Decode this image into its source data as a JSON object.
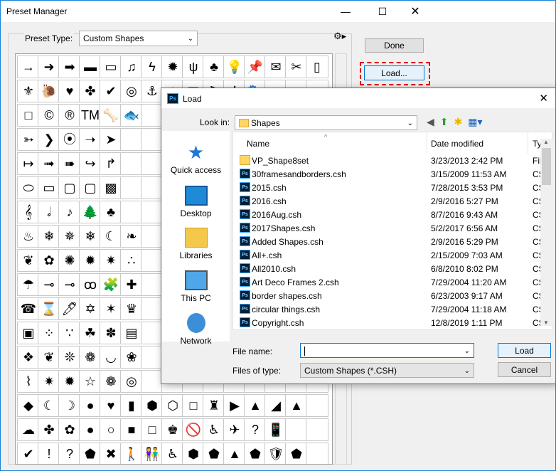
{
  "window": {
    "title": "Preset Manager"
  },
  "preset_type": {
    "label": "Preset Type:",
    "value": "Custom Shapes"
  },
  "buttons": {
    "done": "Done",
    "load": "Load..."
  },
  "shape_grid": {
    "rows": [
      [
        "→",
        "➜",
        "➡",
        "▬",
        "▭",
        "♫",
        "ϟ",
        "✹",
        "ψ",
        "♣",
        "💡",
        "📌",
        "✉",
        "✂",
        "▯"
      ],
      [
        "⚜",
        "🐌",
        "♥",
        "✤",
        "✔",
        "◎",
        "⚓",
        "◆",
        "▦",
        "⚑",
        "✲",
        "🐾",
        "",
        "",
        ""
      ],
      [
        "□",
        "©",
        "®",
        "TM",
        "🦴",
        "🐟",
        "",
        "",
        "",
        "",
        "",
        "",
        "",
        "",
        ""
      ],
      [
        "➳",
        "❯",
        "⦿",
        "➝",
        "➤",
        "",
        "",
        "",
        "",
        "",
        "",
        "",
        "",
        "",
        ""
      ],
      [
        "↦",
        "➟",
        "➠",
        "↪",
        "↱",
        "",
        "",
        "",
        "",
        "",
        "",
        "",
        "",
        "",
        ""
      ],
      [
        "⬭",
        "▭",
        "▢",
        "▢",
        "▩",
        "",
        "",
        "",
        "",
        "",
        "",
        "",
        "",
        "",
        ""
      ],
      [
        "𝄞",
        "𝅗𝅥",
        "♪",
        "🌲",
        "♣",
        "",
        "",
        "",
        "",
        "",
        "",
        "",
        "",
        "",
        ""
      ],
      [
        "♨",
        "❄",
        "✵",
        "❄",
        "☾",
        "❧",
        "",
        "",
        "",
        "",
        "",
        "",
        "",
        "",
        ""
      ],
      [
        "❦",
        "✿",
        "✺",
        "✹",
        "✷",
        "∴",
        "",
        "",
        "",
        "",
        "",
        "",
        "",
        "",
        ""
      ],
      [
        "☂",
        "⊸",
        "⊸",
        "ꝏ",
        "🧩",
        "✚",
        "",
        "",
        "",
        "",
        "",
        "",
        "",
        "",
        ""
      ],
      [
        "☎",
        "⌛",
        "🖊",
        "✡",
        "✶",
        "♛",
        "",
        "",
        "",
        "",
        "",
        "",
        "",
        "",
        ""
      ],
      [
        "▣",
        "⁘",
        "∵",
        "☘",
        "✽",
        "▤",
        "",
        "",
        "",
        "",
        "",
        "",
        "",
        "",
        ""
      ],
      [
        "❖",
        "❦",
        "❊",
        "❁",
        "◡",
        "❀",
        "",
        "",
        "",
        "",
        "",
        "",
        "",
        "",
        ""
      ],
      [
        "⌇",
        "✷",
        "✹",
        "☆",
        "❁",
        "◎",
        "",
        "",
        "",
        "",
        "",
        "",
        "",
        "",
        ""
      ],
      [
        "◆",
        "☾",
        "☽",
        "●",
        "♥",
        "▮",
        "⬢",
        "⬡",
        "□",
        "♜",
        "▶",
        "▲",
        "◢",
        "▲",
        ""
      ],
      [
        "☁",
        "✤",
        "✿",
        "●",
        "○",
        "■",
        "□",
        "♚",
        "🚫",
        "♿",
        "✈",
        "?",
        "📱",
        "",
        ""
      ],
      [
        "✔",
        "!",
        "?",
        "⬟",
        "✖",
        "🚶",
        "👫",
        "♿",
        "⬢",
        "⬟",
        "▲",
        "⬟",
        "🛡",
        "⬟",
        ""
      ]
    ]
  },
  "load_dialog": {
    "title": "Load",
    "look_in_label": "Look in:",
    "look_in_value": "Shapes",
    "places": [
      "Quick access",
      "Desktop",
      "Libraries",
      "This PC",
      "Network"
    ],
    "columns": {
      "name": "Name",
      "date": "Date modified",
      "type": "Ty"
    },
    "files": [
      {
        "name": "VP_Shape8set",
        "date": "3/23/2013 2:42 PM",
        "type": "Fil",
        "icon": "folder-icon"
      },
      {
        "name": "30framesandborders.csh",
        "date": "3/15/2009 11:53 AM",
        "type": "CS",
        "icon": "ps-file-icon"
      },
      {
        "name": "2015.csh",
        "date": "7/28/2015 3:53 PM",
        "type": "CS",
        "icon": "ps-file-icon"
      },
      {
        "name": "2016.csh",
        "date": "2/9/2016 5:27 PM",
        "type": "CS",
        "icon": "ps-file-icon"
      },
      {
        "name": "2016Aug.csh",
        "date": "8/7/2016 9:43 AM",
        "type": "CS",
        "icon": "ps-file-icon"
      },
      {
        "name": "2017Shapes.csh",
        "date": "5/2/2017 6:56 AM",
        "type": "CS",
        "icon": "ps-file-icon"
      },
      {
        "name": "Added Shapes.csh",
        "date": "2/9/2016 5:29 PM",
        "type": "CS",
        "icon": "ps-file-icon"
      },
      {
        "name": "All+.csh",
        "date": "2/15/2009 7:03 AM",
        "type": "CS",
        "icon": "ps-file-icon"
      },
      {
        "name": "All2010.csh",
        "date": "6/8/2010 8:02 PM",
        "type": "CS",
        "icon": "ps-file-icon"
      },
      {
        "name": "Art Deco Frames 2.csh",
        "date": "7/29/2004 11:20 AM",
        "type": "CS",
        "icon": "ps-file-icon"
      },
      {
        "name": "border shapes.csh",
        "date": "6/23/2003 9:17 AM",
        "type": "CS",
        "icon": "ps-file-icon"
      },
      {
        "name": "circular things.csh",
        "date": "7/29/2004 11:18 AM",
        "type": "CS",
        "icon": "ps-file-icon"
      },
      {
        "name": "Copyright.csh",
        "date": "12/8/2019 1:11 PM",
        "type": "CS",
        "icon": "ps-file-icon"
      }
    ],
    "file_name_label": "File name:",
    "file_name_value": "",
    "files_of_type_label": "Files of type:",
    "files_of_type_value": "Custom Shapes (*.CSH)",
    "load_button": "Load",
    "cancel_button": "Cancel"
  }
}
